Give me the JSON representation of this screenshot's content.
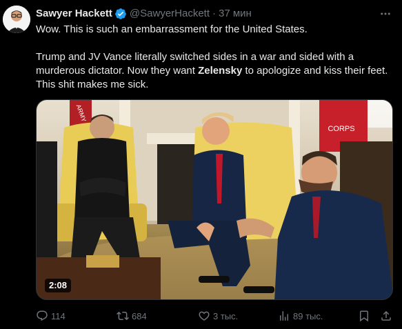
{
  "author": {
    "name": "Sawyer Hackett",
    "handle": "@SawyerHackett",
    "separator": "·",
    "timestamp": "37 мин",
    "verified": true
  },
  "tweet": {
    "line1": "Wow. This is such an embarrassment for the United States.",
    "p2_before": "Trump and JV Vance literally switched sides in a war and sided with a murderous dictator. Now they want ",
    "p2_bold": "Zelensky",
    "p2_after": " to apologize and kiss their feet. This shit makes me sick."
  },
  "media": {
    "duration": "2:08",
    "flag_text": "ARMY",
    "flag_text_2": "CORPS"
  },
  "actions": {
    "replies": "114",
    "reposts": "684",
    "likes": "3 тыс.",
    "views": "89 тыс."
  },
  "icons": {
    "verified": "verified-badge-icon",
    "more": "more-horizontal-icon",
    "reply": "reply-icon",
    "retweet": "retweet-icon",
    "like": "heart-icon",
    "views": "views-icon",
    "bookmark": "bookmark-icon",
    "share": "share-icon"
  },
  "colors": {
    "background": "#000000",
    "text": "#e7e9ea",
    "muted": "#71767b",
    "verified": "#1d9bf0"
  }
}
